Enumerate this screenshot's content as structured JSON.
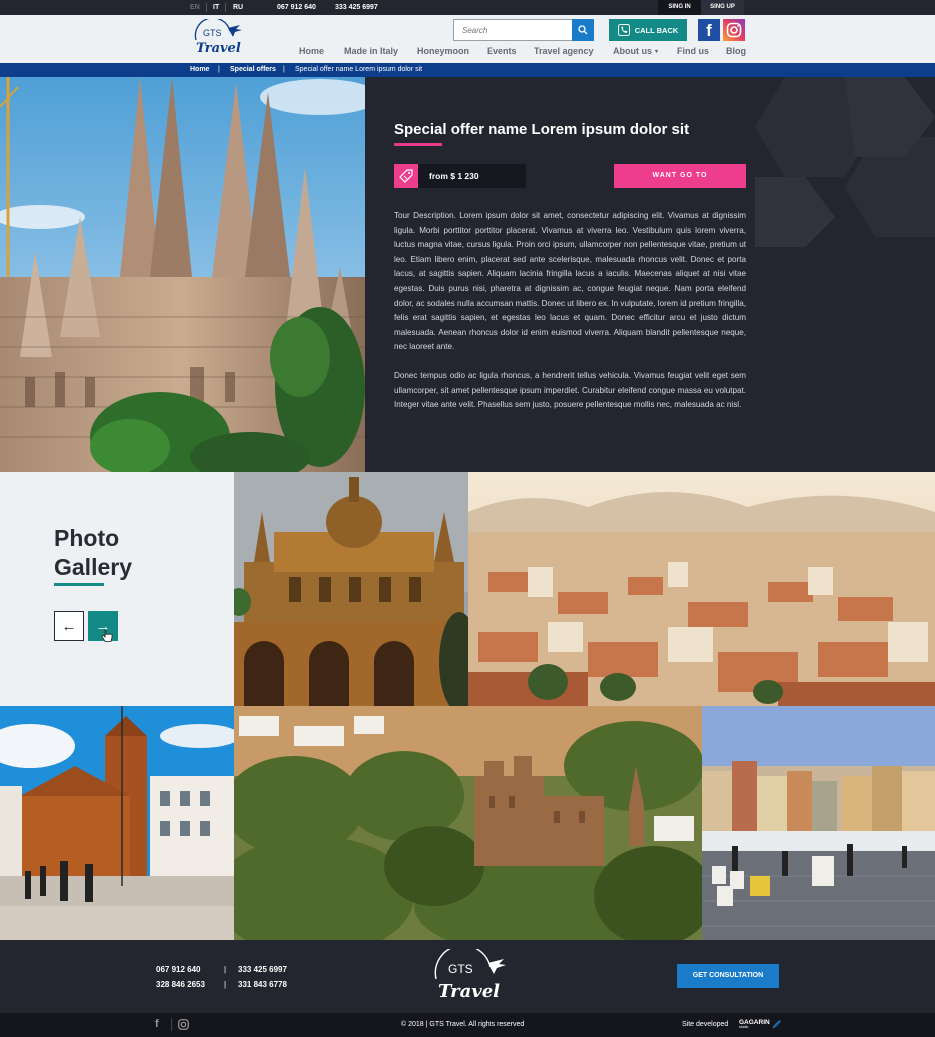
{
  "topbar": {
    "languages": [
      "EN",
      "IT",
      "RU"
    ],
    "phone1": "067 912 640",
    "phone2": "333 425 6997",
    "sign_in": "SING IN",
    "sign_up": "SING UP"
  },
  "header": {
    "logo_top": "GTS",
    "logo_bottom": "Travel",
    "search_placeholder": "Search",
    "call_back": "CALL BACK",
    "nav": [
      "Home",
      "Made in Italy",
      "Honeymoon",
      "Events",
      "Travel agency",
      "About us",
      "Find us",
      "Blog"
    ]
  },
  "breadcrumb": {
    "home": "Home",
    "offers": "Special offers",
    "current": "Special offer name Lorem ipsum dolor sit",
    "separator": "|"
  },
  "offer": {
    "title": "Special offer name Lorem ipsum dolor sit",
    "price": "from $ 1 230",
    "cta": "WANT GO TO",
    "description_1": "Tour Description. Lorem ipsum dolor sit amet, consectetur adipiscing elit. Vivamus at dignissim ligula. Morbi porttitor porttitor placerat. Vivamus at viverra leo. Vestibulum quis lorem viverra, luctus magna vitae, cursus ligula. Proin orci ipsum, ullamcorper non pellentesque vitae, pretium ut leo. Etiam libero enim, placerat sed ante scelerisque, malesuada rhoncus velit. Donec et porta lacus, at sagittis sapien. Aliquam lacinia fringilla lacus a iaculis. Maecenas aliquet at nisi vitae egestas. Duis purus nisi, pharetra at dignissim ac, congue feugiat neque. Nam porta eleifend dolor, ac sodales nulla accumsan mattis. Donec ut libero ex. In vulputate, lorem id pretium fringilla, felis erat sagittis sapien, et egestas leo lacus et quam. Donec efficitur arcu et justo dictum malesuada. Aenean rhoncus dolor id enim euismod viverra. Aliquam blandit pellentesque neque, nec laoreet ante.",
    "description_2": "Donec tempus odio ac ligula rhoncus, a hendrerit tellus vehicula. Vivamus feugiat velit eget sem ullamcorper, sit amet pellentesque ipsum imperdiet. Curabitur eleifend congue massa eu volutpat. Integer vitae ante velit. Phasellus sem justo, posuere pellentesque mollis nec, malesuada ac nisl."
  },
  "gallery": {
    "title_line1": "Photo",
    "title_line2": "Gallery",
    "prev": "←",
    "next": "→"
  },
  "footer": {
    "phones": [
      "067 912 640",
      "333 425 6997",
      "328 846 2653",
      "331 843 6778"
    ],
    "separator": "|",
    "consultation": "GET CONSULTATION",
    "copyright": "© 2018   |   GTS Travel. All rights reserved",
    "site_developed": "Site developed",
    "developer": "GAGARIN",
    "developer_sub": "studio"
  },
  "colors": {
    "dark": "#23252f",
    "pink": "#ef3d8d",
    "teal": "#148a86",
    "blue": "#1a7cc9",
    "navy": "#0d3e8c"
  }
}
